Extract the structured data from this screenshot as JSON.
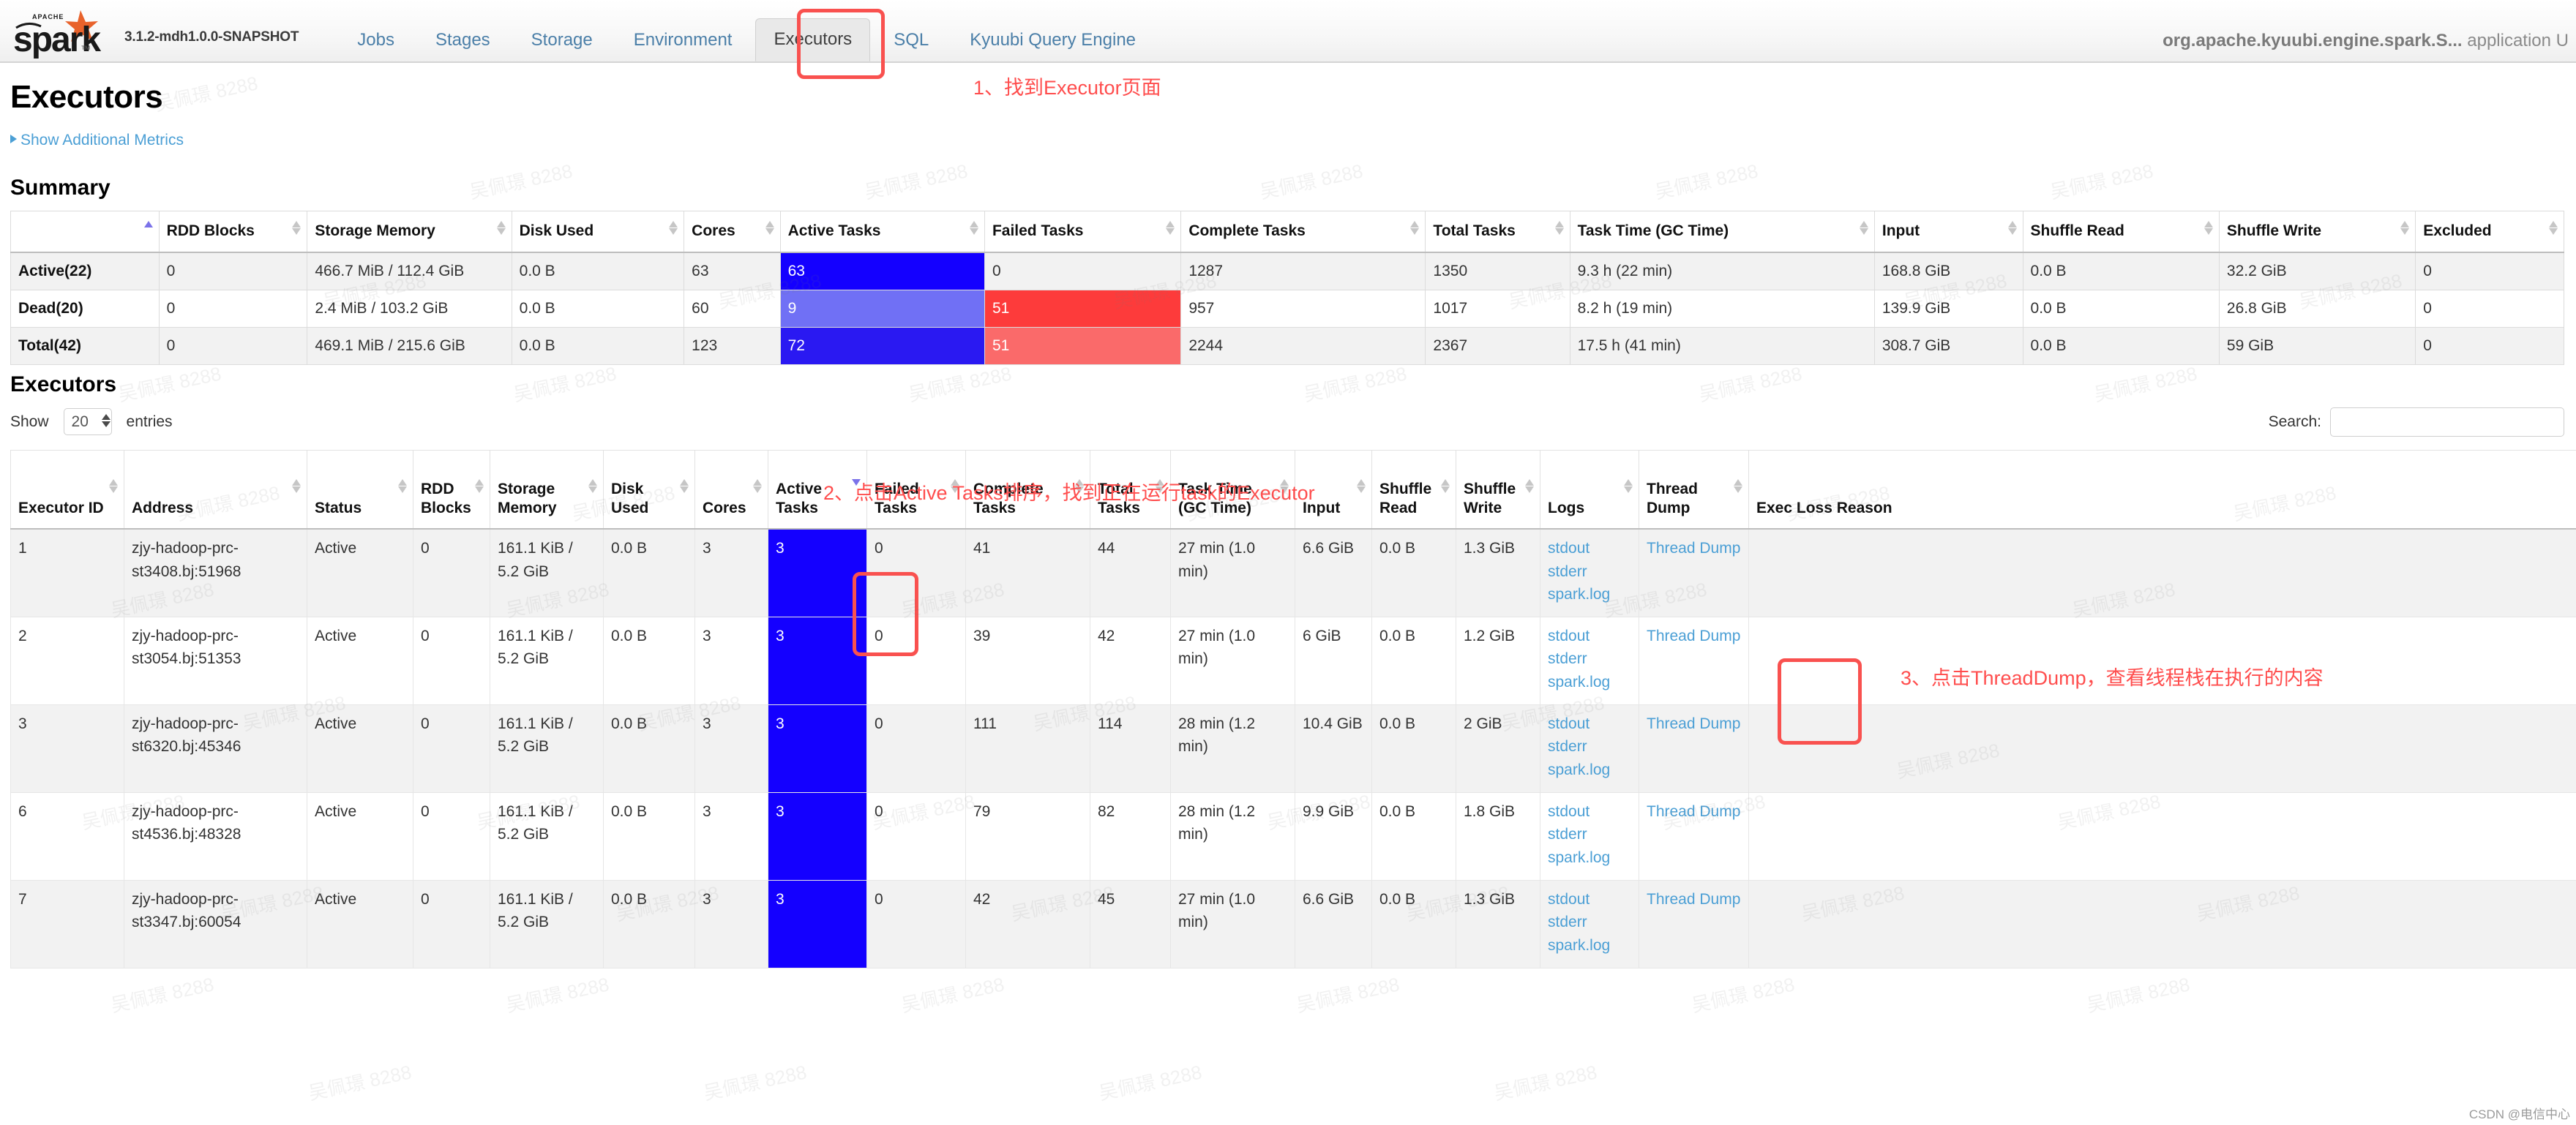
{
  "header": {
    "logo_alt": "Apache Spark",
    "version": "3.1.2-mdh1.0.0-SNAPSHOT",
    "nav": [
      {
        "label": "Jobs",
        "active": false
      },
      {
        "label": "Stages",
        "active": false
      },
      {
        "label": "Storage",
        "active": false
      },
      {
        "label": "Environment",
        "active": false
      },
      {
        "label": "Executors",
        "active": true
      },
      {
        "label": "SQL",
        "active": false
      },
      {
        "label": "Kyuubi Query Engine",
        "active": false
      }
    ],
    "app_name": "org.apache.kyuubi.engine.spark.S...",
    "app_suffix": "application U"
  },
  "page": {
    "title": "Executors",
    "show_additional_metrics": "Show Additional Metrics",
    "summary_title": "Summary",
    "executors_title": "Executors"
  },
  "summary": {
    "columns": [
      {
        "label": "",
        "sort": "asc"
      },
      {
        "label": "RDD Blocks",
        "sort": "none"
      },
      {
        "label": "Storage Memory",
        "sort": "none"
      },
      {
        "label": "Disk Used",
        "sort": "none"
      },
      {
        "label": "Cores",
        "sort": "none"
      },
      {
        "label": "Active Tasks",
        "sort": "none"
      },
      {
        "label": "Failed Tasks",
        "sort": "none"
      },
      {
        "label": "Complete Tasks",
        "sort": "none"
      },
      {
        "label": "Total Tasks",
        "sort": "none"
      },
      {
        "label": "Task Time (GC Time)",
        "sort": "none"
      },
      {
        "label": "Input",
        "sort": "none"
      },
      {
        "label": "Shuffle Read",
        "sort": "none"
      },
      {
        "label": "Shuffle Write",
        "sort": "none"
      },
      {
        "label": "Excluded",
        "sort": "none"
      }
    ],
    "rows": [
      {
        "name": "Active(22)",
        "rdd_blocks": "0",
        "storage_memory": "466.7 MiB / 112.4 GiB",
        "disk_used": "0.0 B",
        "cores": "63",
        "active_tasks": "63",
        "active_bar_pct": 100,
        "active_bar_color": "#1400ff",
        "failed_tasks": "0",
        "failed_bar_pct": 0,
        "failed_bar_color": "",
        "complete_tasks": "1287",
        "total_tasks": "1350",
        "task_time": "9.3 h (22 min)",
        "input": "168.8 GiB",
        "shuffle_read": "0.0 B",
        "shuffle_write": "32.2 GiB",
        "excluded": "0"
      },
      {
        "name": "Dead(20)",
        "rdd_blocks": "0",
        "storage_memory": "2.4 MiB / 103.2 GiB",
        "disk_used": "0.0 B",
        "cores": "60",
        "active_tasks": "9",
        "active_bar_pct": 100,
        "active_bar_color": "#7070f5",
        "failed_tasks": "51",
        "failed_bar_pct": 100,
        "failed_bar_color": "#fd3b3b",
        "complete_tasks": "957",
        "total_tasks": "1017",
        "task_time": "8.2 h (19 min)",
        "input": "139.9 GiB",
        "shuffle_read": "0.0 B",
        "shuffle_write": "26.8 GiB",
        "excluded": "0"
      },
      {
        "name": "Total(42)",
        "rdd_blocks": "0",
        "storage_memory": "469.1 MiB / 215.6 GiB",
        "disk_used": "0.0 B",
        "cores": "123",
        "active_tasks": "72",
        "active_bar_pct": 100,
        "active_bar_color": "#2a19f2",
        "failed_tasks": "51",
        "failed_bar_pct": 100,
        "failed_bar_color": "#fa6a6a",
        "complete_tasks": "2244",
        "total_tasks": "2367",
        "task_time": "17.5 h (41 min)",
        "input": "308.7 GiB",
        "shuffle_read": "0.0 B",
        "shuffle_write": "59 GiB",
        "excluded": "0"
      }
    ]
  },
  "controls": {
    "show_label": "Show",
    "entries_value": "20",
    "entries_label": "entries",
    "search_label": "Search:",
    "search_value": "",
    "search_placeholder": ""
  },
  "executors": {
    "columns": [
      {
        "label": "Executor ID",
        "sort": "none"
      },
      {
        "label": "Address",
        "sort": "none"
      },
      {
        "label": "Status",
        "sort": "none"
      },
      {
        "label": "RDD Blocks",
        "sort": "none"
      },
      {
        "label": "Storage Memory",
        "sort": "none"
      },
      {
        "label": "Disk Used",
        "sort": "none"
      },
      {
        "label": "Cores",
        "sort": "none"
      },
      {
        "label": "Active Tasks",
        "sort": "desc"
      },
      {
        "label": "Failed Tasks",
        "sort": "none"
      },
      {
        "label": "Complete Tasks",
        "sort": "none"
      },
      {
        "label": "Total Tasks",
        "sort": "none"
      },
      {
        "label": "Task Time (GC Time)",
        "sort": "none"
      },
      {
        "label": "Input",
        "sort": "none"
      },
      {
        "label": "Shuffle Read",
        "sort": "none"
      },
      {
        "label": "Shuffle Write",
        "sort": "none"
      },
      {
        "label": "Logs",
        "sort": "none"
      },
      {
        "label": "Thread Dump",
        "sort": "none"
      },
      {
        "label": "Exec Loss Reason",
        "sort": "none"
      }
    ],
    "log_links": [
      "stdout",
      "stderr",
      "spark.log"
    ],
    "thread_dump_label": "Thread Dump",
    "rows": [
      {
        "id": "1",
        "address": "zjy-hadoop-prc-st3408.bj:51968",
        "status": "Active",
        "rdd_blocks": "0",
        "storage_memory": "161.1 KiB / 5.2 GiB",
        "disk_used": "0.0 B",
        "cores": "3",
        "active_tasks": "3",
        "failed_tasks": "0",
        "complete_tasks": "41",
        "total_tasks": "44",
        "task_time": "27 min (1.0 min)",
        "input": "6.6 GiB",
        "shuffle_read": "0.0 B",
        "shuffle_write": "1.3 GiB",
        "exec_loss_reason": ""
      },
      {
        "id": "2",
        "address": "zjy-hadoop-prc-st3054.bj:51353",
        "status": "Active",
        "rdd_blocks": "0",
        "storage_memory": "161.1 KiB / 5.2 GiB",
        "disk_used": "0.0 B",
        "cores": "3",
        "active_tasks": "3",
        "failed_tasks": "0",
        "complete_tasks": "39",
        "total_tasks": "42",
        "task_time": "27 min (1.0 min)",
        "input": "6 GiB",
        "shuffle_read": "0.0 B",
        "shuffle_write": "1.2 GiB",
        "exec_loss_reason": ""
      },
      {
        "id": "3",
        "address": "zjy-hadoop-prc-st6320.bj:45346",
        "status": "Active",
        "rdd_blocks": "0",
        "storage_memory": "161.1 KiB / 5.2 GiB",
        "disk_used": "0.0 B",
        "cores": "3",
        "active_tasks": "3",
        "failed_tasks": "0",
        "complete_tasks": "111",
        "total_tasks": "114",
        "task_time": "28 min (1.2 min)",
        "input": "10.4 GiB",
        "shuffle_read": "0.0 B",
        "shuffle_write": "2 GiB",
        "exec_loss_reason": ""
      },
      {
        "id": "6",
        "address": "zjy-hadoop-prc-st4536.bj:48328",
        "status": "Active",
        "rdd_blocks": "0",
        "storage_memory": "161.1 KiB / 5.2 GiB",
        "disk_used": "0.0 B",
        "cores": "3",
        "active_tasks": "3",
        "failed_tasks": "0",
        "complete_tasks": "79",
        "total_tasks": "82",
        "task_time": "28 min (1.2 min)",
        "input": "9.9 GiB",
        "shuffle_read": "0.0 B",
        "shuffle_write": "1.8 GiB",
        "exec_loss_reason": ""
      },
      {
        "id": "7",
        "address": "zjy-hadoop-prc-st3347.bj:60054",
        "status": "Active",
        "rdd_blocks": "0",
        "storage_memory": "161.1 KiB / 5.2 GiB",
        "disk_used": "0.0 B",
        "cores": "3",
        "active_tasks": "3",
        "failed_tasks": "0",
        "complete_tasks": "42",
        "total_tasks": "45",
        "task_time": "27 min (1.0 min)",
        "input": "6.6 GiB",
        "shuffle_read": "0.0 B",
        "shuffle_write": "1.3 GiB",
        "exec_loss_reason": ""
      }
    ]
  },
  "annotations": {
    "step1": "1、找到Executor页面",
    "step2": "2、点击Active Tasks排序，找到正在运行task的Executor",
    "step3": "3、点击ThreadDump，查看线程栈在执行的内容",
    "color": "#ff4d4d"
  },
  "watermark": {
    "text": "吴佩璟 8288",
    "csdn": "CSDN @电信中心"
  }
}
